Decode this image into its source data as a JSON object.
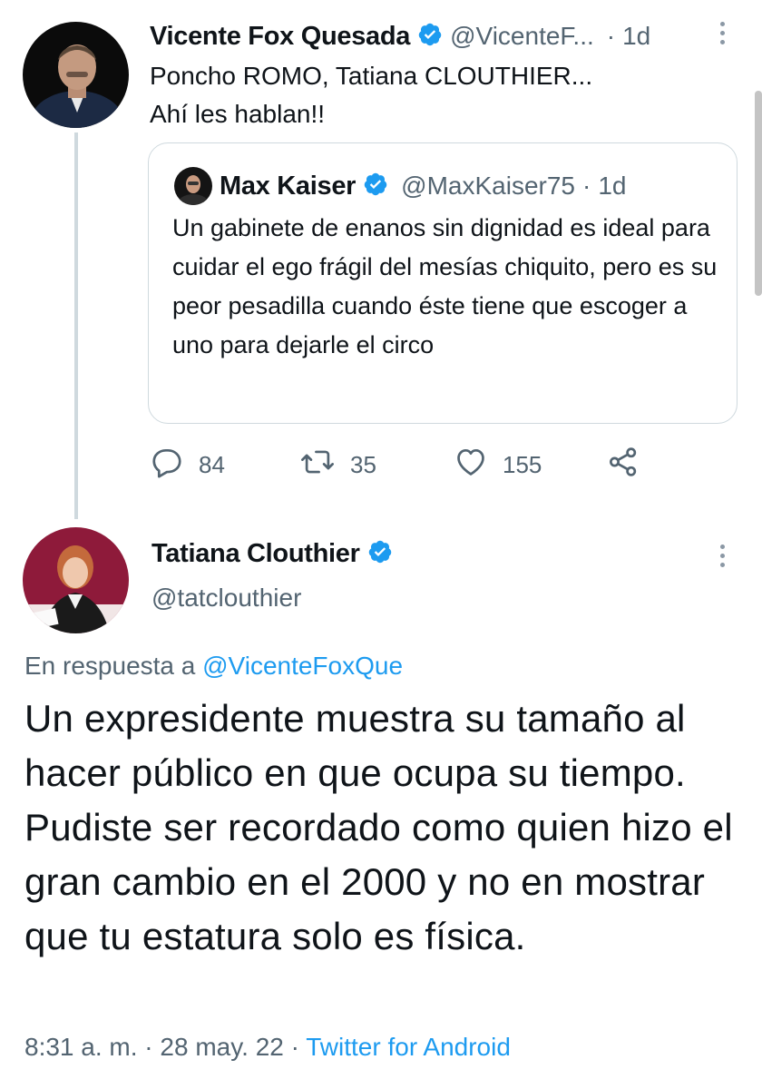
{
  "tweet1": {
    "author_name": "Vicente Fox Quesada",
    "handle": "@VicenteF...",
    "separator": "·",
    "time": "1d",
    "text": "Poncho ROMO, Tatiana CLOUTHIER...\nAhí les hablan!!"
  },
  "quoted": {
    "author_name": "Max Kaiser",
    "handle": "@MaxKaiser75",
    "separator": "·",
    "time": "1d",
    "text": "Un gabinete de enanos sin dignidad es ideal para cuidar el ego frágil del mesías chiquito, pero es su peor pesadilla cuando éste tiene que escoger a uno para dejarle el circo"
  },
  "actions": {
    "replies": "84",
    "retweets": "35",
    "likes": "155"
  },
  "tweet2": {
    "author_name": "Tatiana Clouthier",
    "handle": "@tatclouthier",
    "reply_prefix": "En respuesta a ",
    "reply_target": "@VicenteFoxQue",
    "text": "Un expresidente muestra su tamaño al hacer público en que ocupa su tiempo. Pudiste ser recordado como quien hizo el gran cambio en el 2000 y no en mostrar que tu estatura solo es  física.",
    "time": "8:31 a. m.",
    "date": "28 may. 22",
    "separator": "·",
    "source": "Twitter for Android"
  },
  "icons": {
    "verified": "verified-badge-icon",
    "reply": "reply-icon",
    "retweet": "retweet-icon",
    "like": "heart-icon",
    "share": "share-icon",
    "more": "more-icon"
  },
  "colors": {
    "accent": "#1d9bf0",
    "muted": "#536471",
    "border": "#cfd9de"
  }
}
